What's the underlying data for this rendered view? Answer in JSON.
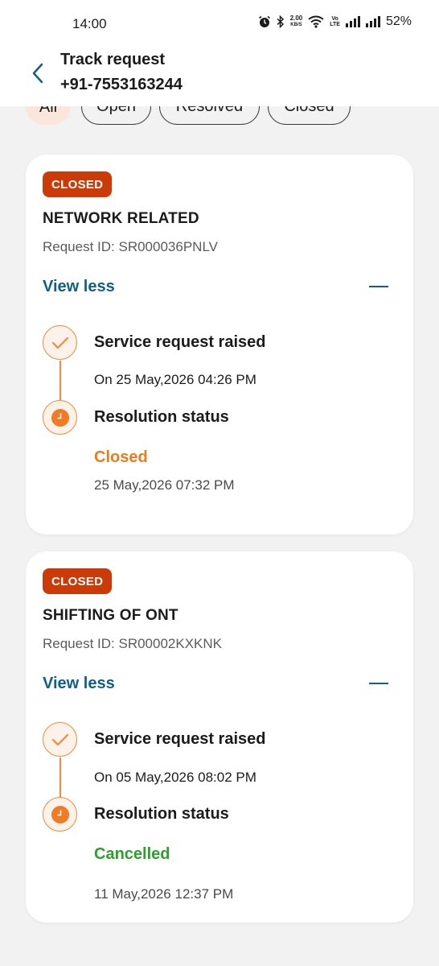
{
  "status_bar": {
    "time": "14:00",
    "speed_top": "2.00",
    "speed_unit": "KB/S",
    "volte_top": "Vo",
    "volte_bottom": "LTE",
    "battery": "52%"
  },
  "header": {
    "title": "Track request",
    "subtitle": "+91-7553163244"
  },
  "filters": [
    {
      "label": "All",
      "active": true
    },
    {
      "label": "Open",
      "active": false
    },
    {
      "label": "Resolved",
      "active": false
    },
    {
      "label": "Closed",
      "active": false
    }
  ],
  "requests": [
    {
      "badge": "CLOSED",
      "category": "NETWORK RELATED",
      "request_id": "Request ID: SR000036PNLV",
      "toggle_label": "View less",
      "step1_title": "Service request raised",
      "step1_date": "On 25 May,2026 04:26 PM",
      "step2_title": "Resolution status",
      "status": "Closed",
      "status_date": "25 May,2026 07:32 PM"
    },
    {
      "badge": "CLOSED",
      "category": "SHIFTING OF ONT",
      "request_id": "Request ID: SR00002KXKNK",
      "toggle_label": "View less",
      "step1_title": "Service request raised",
      "step1_date": "On 05 May,2026 08:02 PM",
      "step2_title": "Resolution status",
      "status": "Cancelled",
      "status_date": "11 May,2026 12:37 PM"
    }
  ],
  "colors": {
    "accent_blue": "#0f5f86",
    "badge_red": "#cc3b07",
    "status_orange": "#ed7b1a",
    "status_green": "#2ca02c",
    "timeline_orange": "#f08a3c"
  },
  "icons": {
    "back": "chevron-left-icon",
    "step_done": "check-icon",
    "step_status": "clock-icon",
    "collapse": "minus-icon"
  }
}
